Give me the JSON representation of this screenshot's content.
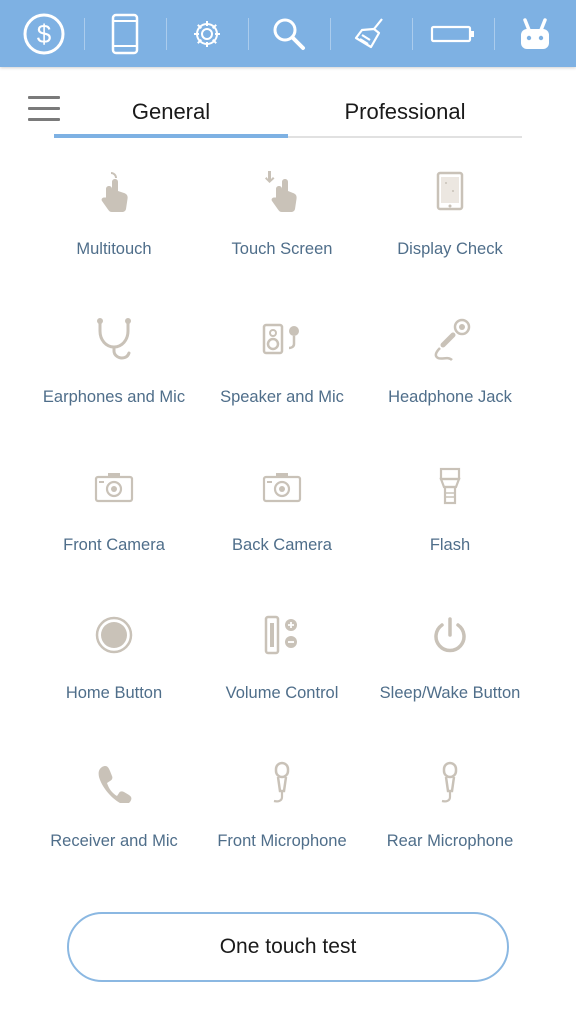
{
  "colors": {
    "topbar": "#7eb1e3",
    "accent": "#7eb1e3",
    "icon_gray": "#c9c2b8",
    "label_blue": "#4f6e8a"
  },
  "topbar": {
    "icons": [
      "dollar-icon",
      "phone-icon",
      "gear-icon",
      "search-icon",
      "broom-icon",
      "battery-icon",
      "rabbit-icon"
    ]
  },
  "tabs": {
    "general": "General",
    "professional": "Professional",
    "active": "General"
  },
  "tests": [
    {
      "label": "Multitouch",
      "icon": "multitouch-icon"
    },
    {
      "label": "Touch Screen",
      "icon": "touch-screen-icon"
    },
    {
      "label": "Display Check",
      "icon": "display-check-icon"
    },
    {
      "label": "Earphones and Mic",
      "icon": "earphones-icon"
    },
    {
      "label": "Speaker and Mic",
      "icon": "speaker-mic-icon"
    },
    {
      "label": "Headphone Jack",
      "icon": "headphone-jack-icon"
    },
    {
      "label": "Front Camera",
      "icon": "camera-icon"
    },
    {
      "label": "Back Camera",
      "icon": "camera-icon"
    },
    {
      "label": "Flash",
      "icon": "flash-icon"
    },
    {
      "label": "Home Button",
      "icon": "home-button-icon"
    },
    {
      "label": "Volume Control",
      "icon": "volume-control-icon"
    },
    {
      "label": "Sleep/Wake Button",
      "icon": "power-icon"
    },
    {
      "label": "Receiver and Mic",
      "icon": "receiver-icon"
    },
    {
      "label": "Front Microphone",
      "icon": "microphone-icon"
    },
    {
      "label": "Rear Microphone",
      "icon": "microphone-icon"
    }
  ],
  "button": {
    "one_touch": "One touch test"
  }
}
